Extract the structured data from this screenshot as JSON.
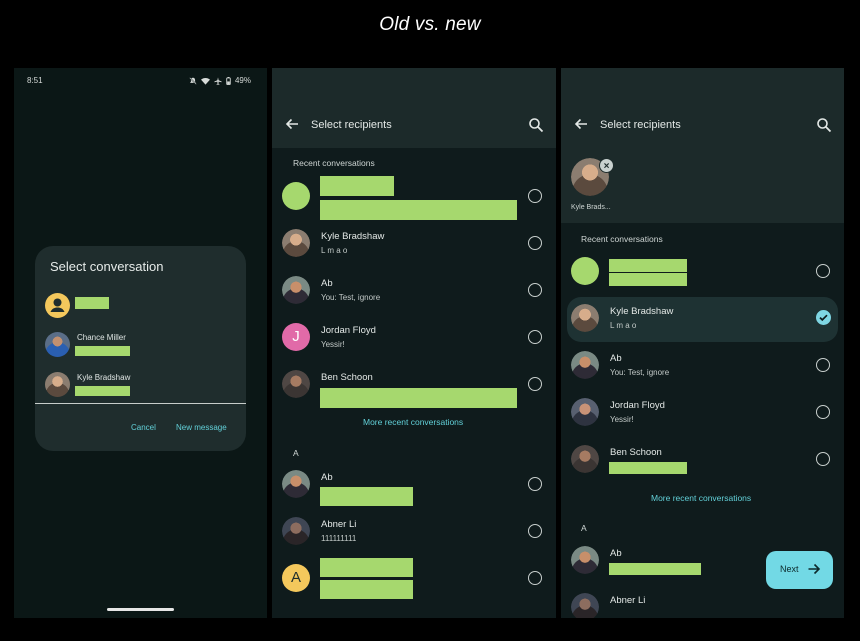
{
  "title": "Old vs. new",
  "old": {
    "status": {
      "time": "8:51",
      "battery": "49%"
    },
    "dialog": {
      "title": "Select conversation",
      "contacts": [
        {
          "name": "",
          "icon": "person-icon"
        },
        {
          "name": "Chance Miller",
          "icon": "avatar"
        },
        {
          "name": "Kyle Bradshaw",
          "icon": "avatar"
        }
      ],
      "cancel": "Cancel",
      "new_message": "New message"
    }
  },
  "new_a": {
    "appbar": {
      "title": "Select recipients"
    },
    "recent_header": "Recent conversations",
    "recent": [
      {
        "name": "",
        "sub": ""
      },
      {
        "name": "Kyle Bradshaw",
        "sub": "L m a o"
      },
      {
        "name": "Ab",
        "sub": "You: Test, ignore"
      },
      {
        "name": "Jordan Floyd",
        "sub": "Yessir!",
        "initial": "J"
      },
      {
        "name": "Ben Schoon",
        "sub": ""
      }
    ],
    "more": "More recent conversations",
    "letter": "A",
    "contacts": [
      {
        "name": "Ab",
        "sub": ""
      },
      {
        "name": "Abner Li",
        "sub": "111111111"
      },
      {
        "name": "",
        "sub": "",
        "initial": "A"
      }
    ]
  },
  "new_b": {
    "appbar": {
      "title": "Select recipients"
    },
    "chip_label": "Kyle Brads...",
    "recent_header": "Recent conversations",
    "recent": [
      {
        "name": "",
        "sub": ""
      },
      {
        "name": "Kyle Bradshaw",
        "sub": "L m a o"
      },
      {
        "name": "Ab",
        "sub": "You: Test, ignore"
      },
      {
        "name": "Jordan Floyd",
        "sub": "Yessir!"
      },
      {
        "name": "Ben Schoon",
        "sub": ""
      }
    ],
    "more": "More recent conversations",
    "letter": "A",
    "contacts": [
      {
        "name": "Ab",
        "sub": ""
      },
      {
        "name": "Abner Li",
        "sub": ""
      }
    ],
    "next": "Next"
  },
  "colors": {
    "redaction": "#a6d86e",
    "accent": "#62d0d8",
    "next_button": "#72d9e5",
    "jordan_avatar": "#e16aa8",
    "placeholder_avatar": "#f4c85c"
  }
}
